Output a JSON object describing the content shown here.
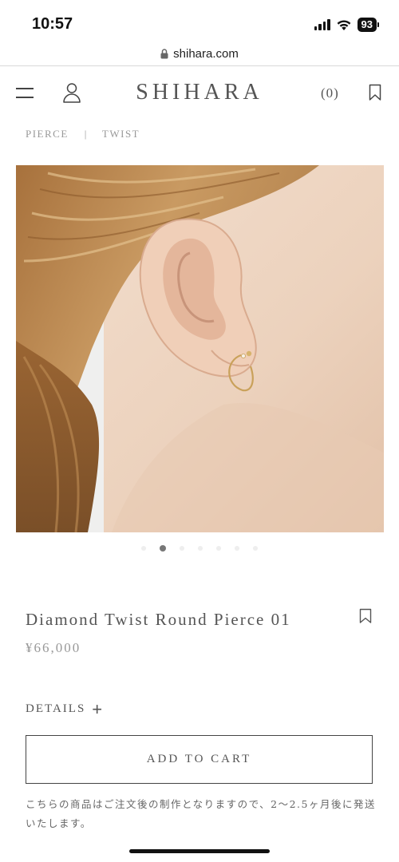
{
  "status_bar": {
    "time": "10:57",
    "battery": "93",
    "icons": [
      "signal-icon",
      "wifi-icon",
      "battery-icon"
    ]
  },
  "browser": {
    "url": "shihara.com"
  },
  "header": {
    "logo": "SHIHARA",
    "cart_count": "(0)",
    "icons": [
      "hamburger-menu-icon",
      "user-icon",
      "bookmark-icon"
    ]
  },
  "breadcrumb": {
    "items": [
      "PIERCE",
      "TWIST"
    ],
    "separator": "|"
  },
  "gallery": {
    "total_images": 7,
    "active_index": 1
  },
  "product": {
    "title": "Diamond Twist Round Pierce 01",
    "price": "¥66,000",
    "details_label": "DETAILS",
    "details_toggle": "+",
    "add_to_cart_label": "ADD TO CART",
    "notice": "こちらの商品はご注文後の制作となりますので、2〜2.5ヶ月後に発送いたします。"
  },
  "colors": {
    "text": "#555555",
    "muted": "#999999",
    "border": "#444444",
    "accent_dot": "#777777"
  }
}
